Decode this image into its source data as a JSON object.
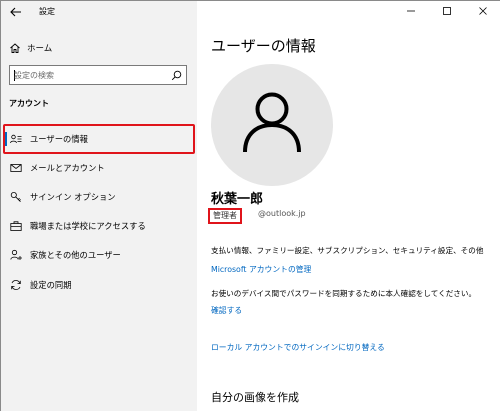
{
  "window": {
    "title": "設定"
  },
  "sidebar": {
    "home_label": "ホーム",
    "search_placeholder": "設定の検索",
    "section_heading": "アカウント",
    "items": [
      {
        "label": "ユーザーの情報",
        "icon": "user-info-icon"
      },
      {
        "label": "メールとアカウント",
        "icon": "mail-icon"
      },
      {
        "label": "サインイン オプション",
        "icon": "key-icon"
      },
      {
        "label": "職場または学校にアクセスする",
        "icon": "briefcase-icon"
      },
      {
        "label": "家族とその他のユーザー",
        "icon": "person-add-icon"
      },
      {
        "label": "設定の同期",
        "icon": "sync-icon"
      }
    ],
    "active_index": 0
  },
  "main": {
    "title": "ユーザーの情報",
    "user_name": "秋葉一郎",
    "role": "管理者",
    "email": "@outlook.jp",
    "billing_text": "支払い情報、ファミリー設定、サブスクリプション、セキュリティ設定、その他",
    "manage_link": "Microsoft アカウントの管理",
    "sync_text": "お使いのデバイス間でパスワードを同期するために本人確認をしてください。",
    "verify_link": "確認する",
    "local_link": "ローカル アカウントでのサインインに切り替える",
    "create_picture_heading": "自分の画像を作成"
  },
  "colors": {
    "accent": "#0067c0",
    "highlight": "#e0141b",
    "sidebar_bg": "#f2f2f2"
  }
}
